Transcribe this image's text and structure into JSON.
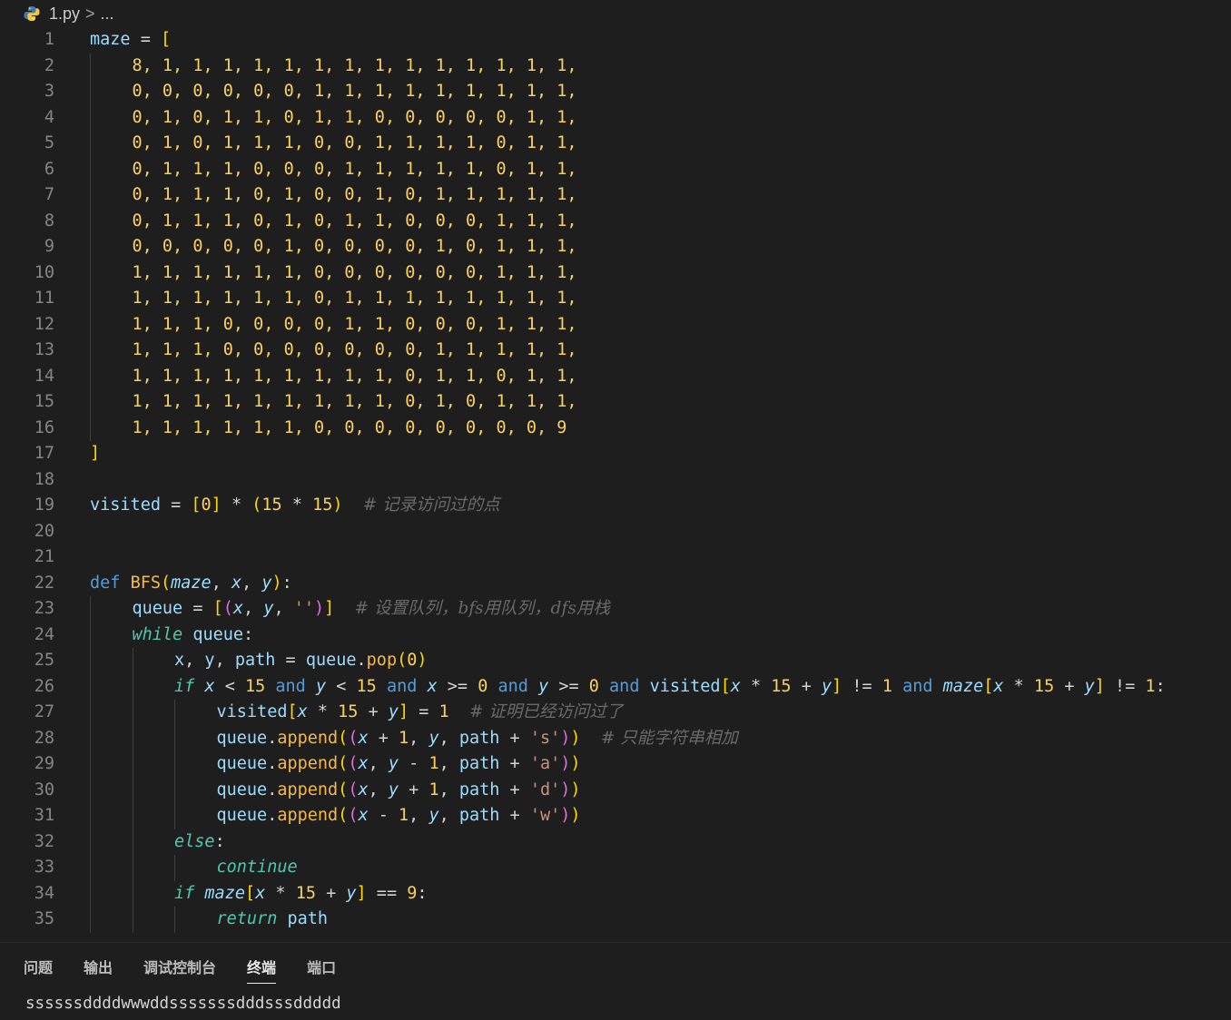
{
  "breadcrumb": {
    "file": "1.py",
    "separator": ">",
    "rest": "..."
  },
  "code_lines": [
    {
      "n": "1",
      "indent": 0,
      "tokens": [
        [
          "var",
          "maze"
        ],
        [
          "op",
          " = "
        ],
        [
          "b1",
          "["
        ]
      ]
    },
    {
      "n": "2",
      "indent": 1,
      "tokens": [
        [
          "num",
          "8, 1, 1, 1, 1, 1, 1, 1, 1, 1, 1, 1, 1, 1, 1,"
        ]
      ]
    },
    {
      "n": "3",
      "indent": 1,
      "tokens": [
        [
          "num",
          "0, 0, 0, 0, 0, 0, 1, 1, 1, 1, 1, 1, 1, 1, 1,"
        ]
      ]
    },
    {
      "n": "4",
      "indent": 1,
      "tokens": [
        [
          "num",
          "0, 1, 0, 1, 1, 0, 1, 1, 0, 0, 0, 0, 0, 1, 1,"
        ]
      ]
    },
    {
      "n": "5",
      "indent": 1,
      "tokens": [
        [
          "num",
          "0, 1, 0, 1, 1, 1, 0, 0, 1, 1, 1, 1, 0, 1, 1,"
        ]
      ]
    },
    {
      "n": "6",
      "indent": 1,
      "tokens": [
        [
          "num",
          "0, 1, 1, 1, 0, 0, 0, 1, 1, 1, 1, 1, 0, 1, 1,"
        ]
      ]
    },
    {
      "n": "7",
      "indent": 1,
      "tokens": [
        [
          "num",
          "0, 1, 1, 1, 0, 1, 0, 0, 1, 0, 1, 1, 1, 1, 1,"
        ]
      ]
    },
    {
      "n": "8",
      "indent": 1,
      "tokens": [
        [
          "num",
          "0, 1, 1, 1, 0, 1, 0, 1, 1, 0, 0, 0, 1, 1, 1,"
        ]
      ]
    },
    {
      "n": "9",
      "indent": 1,
      "tokens": [
        [
          "num",
          "0, 0, 0, 0, 0, 1, 0, 0, 0, 0, 1, 0, 1, 1, 1,"
        ]
      ]
    },
    {
      "n": "10",
      "indent": 1,
      "tokens": [
        [
          "num",
          "1, 1, 1, 1, 1, 1, 0, 0, 0, 0, 0, 0, 1, 1, 1,"
        ]
      ]
    },
    {
      "n": "11",
      "indent": 1,
      "tokens": [
        [
          "num",
          "1, 1, 1, 1, 1, 1, 0, 1, 1, 1, 1, 1, 1, 1, 1,"
        ]
      ]
    },
    {
      "n": "12",
      "indent": 1,
      "tokens": [
        [
          "num",
          "1, 1, 1, 0, 0, 0, 0, 1, 1, 0, 0, 0, 1, 1, 1,"
        ]
      ]
    },
    {
      "n": "13",
      "indent": 1,
      "tokens": [
        [
          "num",
          "1, 1, 1, 0, 0, 0, 0, 0, 0, 0, 1, 1, 1, 1, 1,"
        ]
      ]
    },
    {
      "n": "14",
      "indent": 1,
      "tokens": [
        [
          "num",
          "1, 1, 1, 1, 1, 1, 1, 1, 1, 0, 1, 1, 0, 1, 1,"
        ]
      ]
    },
    {
      "n": "15",
      "indent": 1,
      "tokens": [
        [
          "num",
          "1, 1, 1, 1, 1, 1, 1, 1, 1, 0, 1, 0, 1, 1, 1,"
        ]
      ]
    },
    {
      "n": "16",
      "indent": 1,
      "tokens": [
        [
          "num",
          "1, 1, 1, 1, 1, 1, 0, 0, 0, 0, 0, 0, 0, 0, 9"
        ]
      ]
    },
    {
      "n": "17",
      "indent": 0,
      "tokens": [
        [
          "b1",
          "]"
        ]
      ]
    },
    {
      "n": "18",
      "indent": 0,
      "tokens": []
    },
    {
      "n": "19",
      "indent": 0,
      "tokens": [
        [
          "var",
          "visited"
        ],
        [
          "op",
          " = "
        ],
        [
          "b1",
          "["
        ],
        [
          "num",
          "0"
        ],
        [
          "b1",
          "]"
        ],
        [
          "op",
          " * "
        ],
        [
          "b1",
          "("
        ],
        [
          "num",
          "15"
        ],
        [
          "op",
          " * "
        ],
        [
          "num",
          "15"
        ],
        [
          "b1",
          ")"
        ],
        [
          "op",
          "  "
        ],
        [
          "cmt",
          "# 记录访问过的点"
        ]
      ]
    },
    {
      "n": "20",
      "indent": 0,
      "tokens": []
    },
    {
      "n": "21",
      "indent": 0,
      "tokens": []
    },
    {
      "n": "22",
      "indent": 0,
      "tokens": [
        [
          "kw",
          "def "
        ],
        [
          "fn",
          "BFS"
        ],
        [
          "b1",
          "("
        ],
        [
          "prm",
          "maze"
        ],
        [
          "op",
          ", "
        ],
        [
          "prm",
          "x"
        ],
        [
          "op",
          ", "
        ],
        [
          "prm",
          "y"
        ],
        [
          "b1",
          ")"
        ],
        [
          "op",
          ":"
        ]
      ]
    },
    {
      "n": "23",
      "indent": 1,
      "tokens": [
        [
          "var",
          "queue"
        ],
        [
          "op",
          " = "
        ],
        [
          "b1",
          "["
        ],
        [
          "b2",
          "("
        ],
        [
          "prm",
          "x"
        ],
        [
          "op",
          ", "
        ],
        [
          "prm",
          "y"
        ],
        [
          "op",
          ", "
        ],
        [
          "str",
          "''"
        ],
        [
          "b2",
          ")"
        ],
        [
          "b1",
          "]"
        ],
        [
          "op",
          "  "
        ],
        [
          "cmt",
          "# 设置队列，bfs用队列，dfs用栈"
        ]
      ]
    },
    {
      "n": "24",
      "indent": 1,
      "tokens": [
        [
          "ctl",
          "while "
        ],
        [
          "var",
          "queue"
        ],
        [
          "op",
          ":"
        ]
      ]
    },
    {
      "n": "25",
      "indent": 2,
      "tokens": [
        [
          "var",
          "x"
        ],
        [
          "op",
          ", "
        ],
        [
          "var",
          "y"
        ],
        [
          "op",
          ", "
        ],
        [
          "var",
          "path"
        ],
        [
          "op",
          " = "
        ],
        [
          "var",
          "queue"
        ],
        [
          "op",
          "."
        ],
        [
          "fn",
          "pop"
        ],
        [
          "b1",
          "("
        ],
        [
          "num",
          "0"
        ],
        [
          "b1",
          ")"
        ]
      ]
    },
    {
      "n": "26",
      "indent": 2,
      "tokens": [
        [
          "ctl",
          "if "
        ],
        [
          "prm",
          "x"
        ],
        [
          "op",
          " < "
        ],
        [
          "num",
          "15"
        ],
        [
          "kw",
          " and "
        ],
        [
          "prm",
          "y"
        ],
        [
          "op",
          " < "
        ],
        [
          "num",
          "15"
        ],
        [
          "kw",
          " and "
        ],
        [
          "prm",
          "x"
        ],
        [
          "op",
          " >= "
        ],
        [
          "num",
          "0"
        ],
        [
          "kw",
          " and "
        ],
        [
          "prm",
          "y"
        ],
        [
          "op",
          " >= "
        ],
        [
          "num",
          "0"
        ],
        [
          "kw",
          " and "
        ],
        [
          "var",
          "visited"
        ],
        [
          "b1",
          "["
        ],
        [
          "prm",
          "x"
        ],
        [
          "op",
          " * "
        ],
        [
          "num",
          "15"
        ],
        [
          "op",
          " + "
        ],
        [
          "prm",
          "y"
        ],
        [
          "b1",
          "]"
        ],
        [
          "op",
          " != "
        ],
        [
          "num",
          "1"
        ],
        [
          "kw",
          " and "
        ],
        [
          "prm",
          "maze"
        ],
        [
          "b1",
          "["
        ],
        [
          "prm",
          "x"
        ],
        [
          "op",
          " * "
        ],
        [
          "num",
          "15"
        ],
        [
          "op",
          " + "
        ],
        [
          "prm",
          "y"
        ],
        [
          "b1",
          "]"
        ],
        [
          "op",
          " != "
        ],
        [
          "num",
          "1"
        ],
        [
          "op",
          ":"
        ]
      ]
    },
    {
      "n": "27",
      "indent": 3,
      "tokens": [
        [
          "var",
          "visited"
        ],
        [
          "b1",
          "["
        ],
        [
          "prm",
          "x"
        ],
        [
          "op",
          " * "
        ],
        [
          "num",
          "15"
        ],
        [
          "op",
          " + "
        ],
        [
          "prm",
          "y"
        ],
        [
          "b1",
          "]"
        ],
        [
          "op",
          " = "
        ],
        [
          "num",
          "1"
        ],
        [
          "op",
          "  "
        ],
        [
          "cmt",
          "# 证明已经访问过了"
        ]
      ]
    },
    {
      "n": "28",
      "indent": 3,
      "tokens": [
        [
          "var",
          "queue"
        ],
        [
          "op",
          "."
        ],
        [
          "fn",
          "append"
        ],
        [
          "b1",
          "("
        ],
        [
          "b2",
          "("
        ],
        [
          "prm",
          "x"
        ],
        [
          "op",
          " + "
        ],
        [
          "num",
          "1"
        ],
        [
          "op",
          ", "
        ],
        [
          "prm",
          "y"
        ],
        [
          "op",
          ", "
        ],
        [
          "var",
          "path"
        ],
        [
          "op",
          " + "
        ],
        [
          "str",
          "'s'"
        ],
        [
          "b2",
          ")"
        ],
        [
          "b1",
          ")"
        ],
        [
          "op",
          "  "
        ],
        [
          "cmt",
          "# 只能字符串相加"
        ]
      ]
    },
    {
      "n": "29",
      "indent": 3,
      "tokens": [
        [
          "var",
          "queue"
        ],
        [
          "op",
          "."
        ],
        [
          "fn",
          "append"
        ],
        [
          "b1",
          "("
        ],
        [
          "b2",
          "("
        ],
        [
          "prm",
          "x"
        ],
        [
          "op",
          ", "
        ],
        [
          "prm",
          "y"
        ],
        [
          "op",
          " - "
        ],
        [
          "num",
          "1"
        ],
        [
          "op",
          ", "
        ],
        [
          "var",
          "path"
        ],
        [
          "op",
          " + "
        ],
        [
          "str",
          "'a'"
        ],
        [
          "b2",
          ")"
        ],
        [
          "b1",
          ")"
        ]
      ]
    },
    {
      "n": "30",
      "indent": 3,
      "tokens": [
        [
          "var",
          "queue"
        ],
        [
          "op",
          "."
        ],
        [
          "fn",
          "append"
        ],
        [
          "b1",
          "("
        ],
        [
          "b2",
          "("
        ],
        [
          "prm",
          "x"
        ],
        [
          "op",
          ", "
        ],
        [
          "prm",
          "y"
        ],
        [
          "op",
          " + "
        ],
        [
          "num",
          "1"
        ],
        [
          "op",
          ", "
        ],
        [
          "var",
          "path"
        ],
        [
          "op",
          " + "
        ],
        [
          "str",
          "'d'"
        ],
        [
          "b2",
          ")"
        ],
        [
          "b1",
          ")"
        ]
      ]
    },
    {
      "n": "31",
      "indent": 3,
      "tokens": [
        [
          "var",
          "queue"
        ],
        [
          "op",
          "."
        ],
        [
          "fn",
          "append"
        ],
        [
          "b1",
          "("
        ],
        [
          "b2",
          "("
        ],
        [
          "prm",
          "x"
        ],
        [
          "op",
          " - "
        ],
        [
          "num",
          "1"
        ],
        [
          "op",
          ", "
        ],
        [
          "prm",
          "y"
        ],
        [
          "op",
          ", "
        ],
        [
          "var",
          "path"
        ],
        [
          "op",
          " + "
        ],
        [
          "str",
          "'w'"
        ],
        [
          "b2",
          ")"
        ],
        [
          "b1",
          ")"
        ]
      ]
    },
    {
      "n": "32",
      "indent": 2,
      "tokens": [
        [
          "ctl",
          "else"
        ],
        [
          "op",
          ":"
        ]
      ]
    },
    {
      "n": "33",
      "indent": 3,
      "tokens": [
        [
          "ctl",
          "continue"
        ]
      ]
    },
    {
      "n": "34",
      "indent": 2,
      "tokens": [
        [
          "ctl",
          "if "
        ],
        [
          "prm",
          "maze"
        ],
        [
          "b1",
          "["
        ],
        [
          "prm",
          "x"
        ],
        [
          "op",
          " * "
        ],
        [
          "num",
          "15"
        ],
        [
          "op",
          " + "
        ],
        [
          "prm",
          "y"
        ],
        [
          "b1",
          "]"
        ],
        [
          "op",
          " == "
        ],
        [
          "num",
          "9"
        ],
        [
          "op",
          ":"
        ]
      ]
    },
    {
      "n": "35",
      "indent": 3,
      "tokens": [
        [
          "ctl",
          "return "
        ],
        [
          "var",
          "path"
        ]
      ]
    }
  ],
  "panel": {
    "tabs": [
      "问题",
      "输出",
      "调试控制台",
      "终端",
      "端口"
    ],
    "active_tab": "终端",
    "terminal_output": "ssssssddddwwwddsssssssdddsssddddd"
  },
  "icons": {
    "breadcrumb_file": "python-file-icon"
  },
  "colors": {
    "background": "#1e1e1e",
    "keyword": "#569cd6",
    "number": "#fbd15e",
    "variable": "#9cdcfe",
    "string": "#ce9178",
    "comment": "#6a6a6a"
  }
}
